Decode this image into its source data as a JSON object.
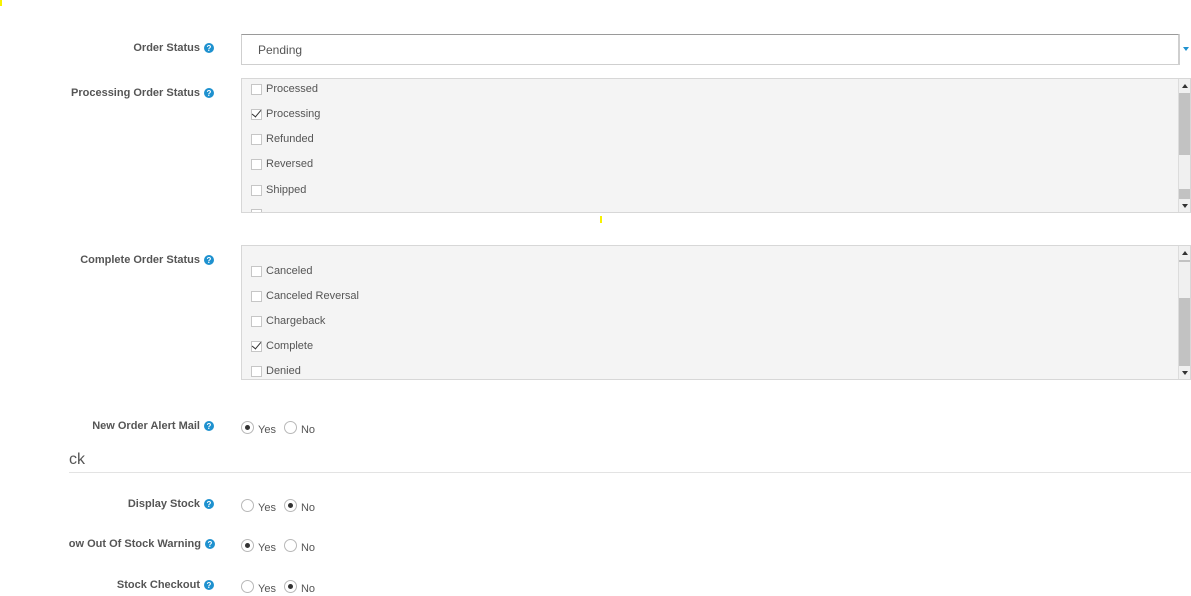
{
  "order_status": {
    "label": "Order Status",
    "selected": "Pending"
  },
  "processing_order_status": {
    "label": "Processing Order Status",
    "items": [
      {
        "label": "Processed",
        "checked": false
      },
      {
        "label": "Processing",
        "checked": true
      },
      {
        "label": "Refunded",
        "checked": false
      },
      {
        "label": "Reversed",
        "checked": false
      },
      {
        "label": "Shipped",
        "checked": false
      }
    ]
  },
  "complete_order_status": {
    "label": "Complete Order Status",
    "items": [
      {
        "label": "Canceled",
        "checked": false
      },
      {
        "label": "Canceled Reversal",
        "checked": false
      },
      {
        "label": "Chargeback",
        "checked": false
      },
      {
        "label": "Complete",
        "checked": true
      },
      {
        "label": "Denied",
        "checked": false
      }
    ]
  },
  "new_order_alert_mail": {
    "label": "New Order Alert Mail",
    "yes": "Yes",
    "no": "No",
    "value": "yes"
  },
  "stock_section": {
    "title": "ck"
  },
  "display_stock": {
    "label": "Display Stock",
    "yes": "Yes",
    "no": "No",
    "value": "no"
  },
  "out_of_stock_warning": {
    "label": "ow Out Of Stock Warning",
    "yes": "Yes",
    "no": "No",
    "value": "yes"
  },
  "stock_checkout": {
    "label": "Stock Checkout",
    "yes": "Yes",
    "no": "No",
    "value": "no"
  },
  "icons": {
    "help": "question-circle-icon",
    "help_glyph": "?"
  }
}
